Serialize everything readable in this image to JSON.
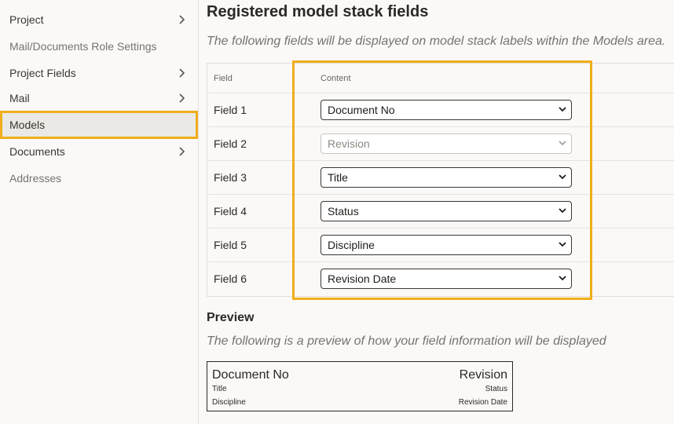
{
  "sidebar": {
    "items": [
      {
        "label": "Project"
      },
      {
        "label": "Mail/Documents Role Settings"
      },
      {
        "label": "Project Fields"
      },
      {
        "label": "Mail"
      },
      {
        "label": "Models"
      },
      {
        "label": "Documents"
      },
      {
        "label": "Addresses"
      }
    ]
  },
  "main": {
    "title": "Registered model stack fields",
    "description": "The following fields will be displayed on model stack labels within the Models area.",
    "table": {
      "headers": {
        "field": "Field",
        "content": "Content"
      },
      "rows": [
        {
          "field": "Field 1",
          "value": "Document No"
        },
        {
          "field": "Field 2",
          "value": "Revision"
        },
        {
          "field": "Field 3",
          "value": "Title"
        },
        {
          "field": "Field 4",
          "value": "Status"
        },
        {
          "field": "Field 5",
          "value": "Discipline"
        },
        {
          "field": "Field 6",
          "value": "Revision Date"
        }
      ]
    },
    "preview": {
      "title": "Preview",
      "description": "The following is a preview of how your field information will be displayed",
      "top_left": "Document No",
      "top_right": "Revision",
      "mid_left": "Title",
      "mid_right": "Status",
      "bottom_left": "Discipline",
      "bottom_right": "Revision Date"
    }
  },
  "colors": {
    "highlight": "#f0ae1a",
    "selected_bg": "#ebe9e6"
  }
}
